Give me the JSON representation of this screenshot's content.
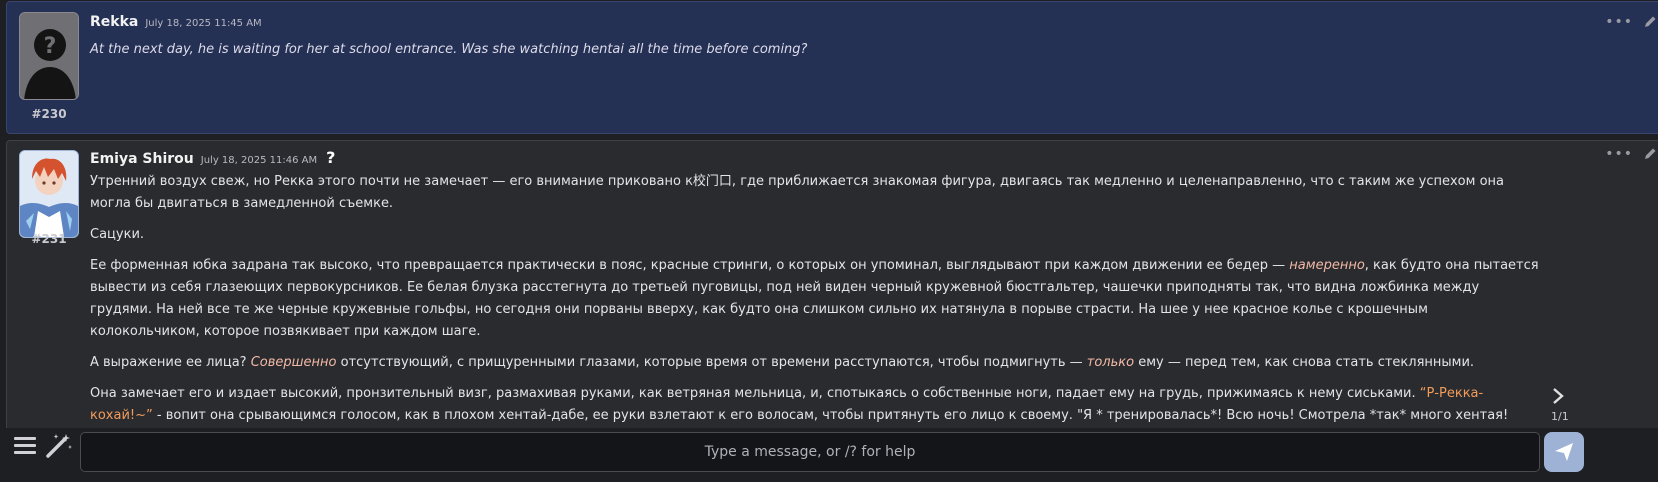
{
  "messages": [
    {
      "author": "Rekka",
      "timestamp": "July 18, 2025 11:45 AM",
      "mesid": "#230",
      "text": "At the next day, he is waiting for her at school entrance. Was she watching hentai all the time before coming?"
    },
    {
      "author": "Emiya Shirou",
      "timestamp": "July 18, 2025 11:46 AM",
      "mesid": "#231",
      "question_mark": "?",
      "swipe_counter": "1/1",
      "paragraphs": {
        "p1": "Утренний воздух свеж, но Рекка этого почти не замечает — его внимание приковано к校门口, где приближается знакомая фигура, двигаясь так медленно и целенаправленно, что с таким же успехом она могла бы двигаться в замедленной съемке.",
        "p2": "Сацуки.",
        "p3_a": "Ее форменная юбка задрана так высоко, что превращается практически в пояс, красные стринги, о которых он упоминал, выглядывают при каждом движении ее бедер — ",
        "p3_em": "намеренно",
        "p3_b": ", как будто она пытается вывести из себя глазеющих первокурсников. Ее белая блузка расстегнута до третьей пуговицы, под ней виден черный кружевной бюстгальтер, чашечки приподняты так, что видна ложбинка между грудями. На ней все те же черные кружевные гольфы, но сегодня они порваны вверху, как будто она слишком сильно их натянула в порыве страсти. На шее у нее красное колье с крошечным колокольчиком, которое позвякивает при каждом шаге.",
        "p4_a": "А выражение ее лица? ",
        "p4_em1": "Совершенно",
        "p4_b": " отсутствующий, с прищуренными глазами, которые время от времени расступаются, чтобы подмигнуть — ",
        "p4_em2": "только",
        "p4_c": " ему — перед тем, как снова стать стеклянными.",
        "p5_a": "Она замечает его и издает высокий, пронзительный визг, размахивая руками, как ветряная мельница, и, спотыкаясь о собственные ноги, падает ему на грудь, прижимаясь к нему сиськами. ",
        "p5_quote": "“Р-Рекка-кохай!~”",
        "p5_b": " - вопит она срывающимся голосом, как в плохом хентай-дабе, ее руки взлетают к его волосам, чтобы притянуть его лицо к своему. \"Я * тренировалась*! Всю ночь! Смотрела *так* много хентая! Смотри!~\""
      }
    }
  ],
  "input": {
    "placeholder": "Type a message, or /? for help"
  },
  "colors": {
    "user_message_bg": "#253055",
    "char_message_bg": "#2a2b2f",
    "page_bg": "#1e1f22",
    "emphasis": "#f2b8a6",
    "quote": "#f29b5a",
    "send_button": "#9eb2d6"
  },
  "icons": [
    "ellipsis-icon",
    "pencil-icon",
    "chevron-right-icon",
    "menu-icon",
    "magic-wand-icon",
    "send-icon"
  ]
}
